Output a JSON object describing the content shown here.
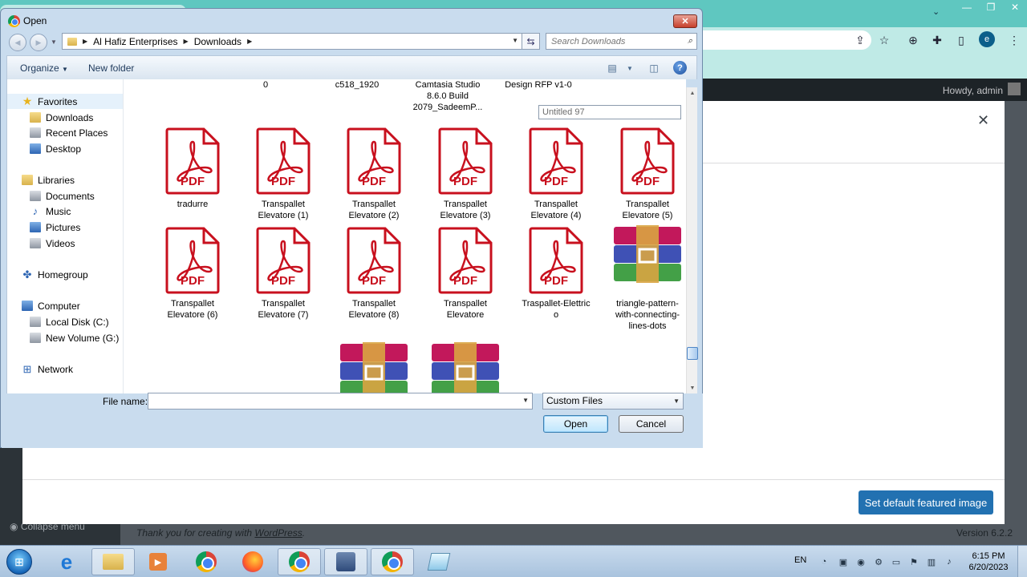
{
  "browser": {
    "toolbar_icons": [
      "share-icon",
      "star-icon",
      "grid-icon",
      "extension-icon",
      "sidebar-icon"
    ],
    "profile_initial": "e"
  },
  "wordpress": {
    "howdy": "Howdy, admin",
    "footer_text_prefix": "Thank you for creating with ",
    "footer_link": "WordPress",
    "footer_suffix": ".",
    "version": "Version 6.2.2",
    "modal_button": "Set default featured image",
    "sidebar_fragments": [
      "Me",
      "Per",
      "Pro",
      "Collapse menu"
    ]
  },
  "dialog": {
    "title": "Open",
    "breadcrumbs": [
      "Al Hafiz Enterprises",
      "Downloads"
    ],
    "search_placeholder": "Search Downloads",
    "organize": "Organize",
    "new_folder": "New folder",
    "nav": {
      "favorites": "Favorites",
      "downloads": "Downloads",
      "recent_places": "Recent Places",
      "desktop": "Desktop",
      "libraries": "Libraries",
      "documents": "Documents",
      "music": "Music",
      "pictures": "Pictures",
      "videos": "Videos",
      "homegroup": "Homegroup",
      "computer": "Computer",
      "local_disk": "Local Disk (C:)",
      "new_volume": "New Volume (G:)",
      "network": "Network"
    },
    "partial_labels": {
      "c1": "0",
      "c2": "c518_1920",
      "c3_l1": "Camtasia Studio",
      "c3_l2": "8.6.0 Build",
      "c3_l3": "2079_SadeemP...",
      "c4": "Design RFP v1-0"
    },
    "rename_value": "Untitled 97",
    "pdf_text": "PDF",
    "files": {
      "f1": [
        "tradurre"
      ],
      "f2": [
        "Transpallet",
        "Elevatore (1)"
      ],
      "f3": [
        "Transpallet",
        "Elevatore (2)"
      ],
      "f4": [
        "Transpallet",
        "Elevatore (3)"
      ],
      "f5": [
        "Transpallet",
        "Elevatore (4)"
      ],
      "f6": [
        "Transpallet",
        "Elevatore (5)"
      ],
      "f7": [
        "Transpallet",
        "Elevatore (6)"
      ],
      "f8": [
        "Transpallet",
        "Elevatore (7)"
      ],
      "f9": [
        "Transpallet",
        "Elevatore (8)"
      ],
      "f10": [
        "Transpallet",
        "Elevatore"
      ],
      "f11": [
        "Traspallet-Elettric",
        "o"
      ],
      "f12": [
        "triangle-pattern-",
        "with-connecting-",
        "lines-dots"
      ]
    },
    "file_name_label": "File name:",
    "file_name_value": "",
    "filter": "Custom Files",
    "open": "Open",
    "cancel": "Cancel"
  },
  "taskbar": {
    "language": "EN",
    "time": "6:15 PM",
    "date": "6/20/2023"
  }
}
